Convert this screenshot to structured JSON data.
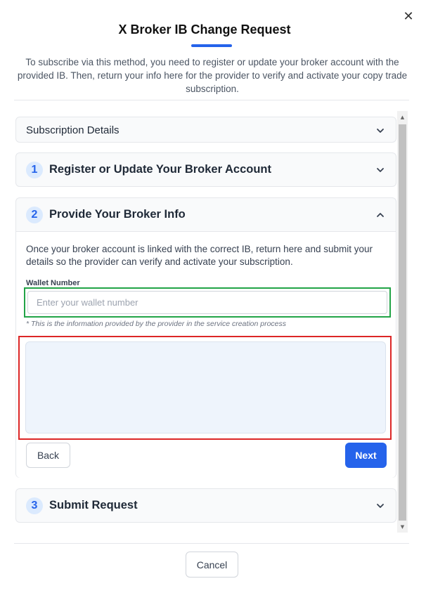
{
  "modal": {
    "title": "X Broker  IB Change Request",
    "intro": "To subscribe via this method, you need to register or update your broker account with the provided IB. Then, return your info here for the provider to verify and activate your copy trade subscription.",
    "close_icon": "close-icon",
    "accent_color": "#2563eb"
  },
  "sections": {
    "details": {
      "title": "Subscription Details"
    },
    "step1": {
      "number": "1",
      "title": "Register or Update Your Broker Account"
    },
    "step2": {
      "number": "2",
      "title": "Provide Your Broker Info",
      "description": "Once your broker account is linked with the correct IB, return here and submit your details so the provider can verify and activate your subscription.",
      "wallet_label": "Wallet Number",
      "wallet_placeholder": "Enter your wallet number",
      "wallet_value": "",
      "hint": "* This is the information provided by the provider in the service creation process",
      "back_label": "Back",
      "next_label": "Next"
    },
    "step3": {
      "number": "3",
      "title": "Submit Request"
    }
  },
  "footer": {
    "cancel_label": "Cancel"
  },
  "highlights": {
    "green": "#22a447",
    "red": "#dc2626"
  }
}
